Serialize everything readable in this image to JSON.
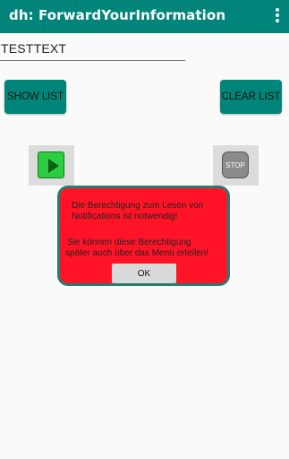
{
  "app_bar": {
    "title": "dh: ForwardYourInformation",
    "overflow_icon": "more-vert-icon",
    "color": "#01857a"
  },
  "text_input": {
    "value": "TESTTEXT"
  },
  "buttons": {
    "show_list": "SHOW LIST",
    "clear_list": "CLEAR LIST"
  },
  "controls": {
    "play_icon": "play-icon",
    "stop_label": "STOP"
  },
  "dialog": {
    "line1": "Die Berechtigung zum Lesen von",
    "line2": "Notifications ist notwendig!",
    "line3": "Sie können diese Berechtigung",
    "line4": "später auch über das Menü erteilen!",
    "ok_label": "OK",
    "background_color": "#ff1427",
    "border_color": "#2a7a73"
  }
}
